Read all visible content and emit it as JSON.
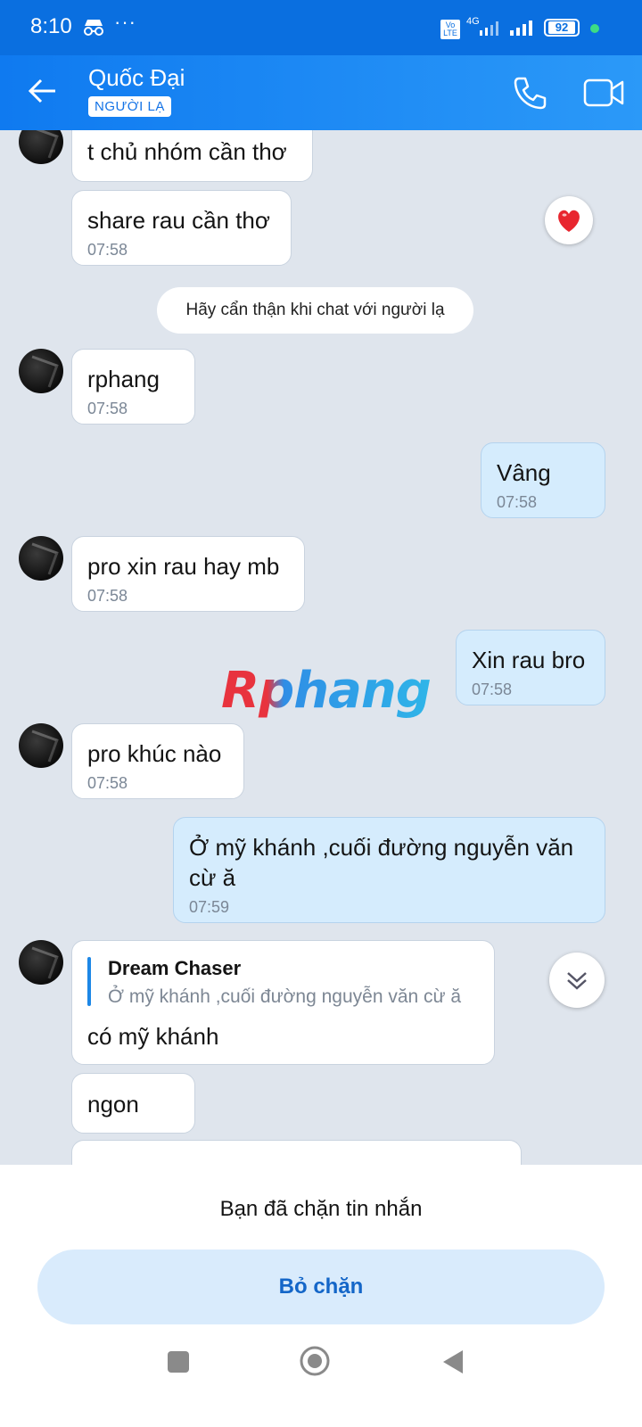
{
  "status_bar": {
    "time": "8:10",
    "more": "···",
    "network_label": "4G",
    "volte_label": "Vo LTE",
    "battery": "92"
  },
  "header": {
    "contact_name": "Quốc Đại",
    "badge": "NGƯỜI LẠ",
    "icons": [
      "back-arrow-icon",
      "phone-icon",
      "video-call-icon"
    ]
  },
  "messages": [
    {
      "side": "in",
      "text": "t chủ nhóm cần thơ",
      "time": ""
    },
    {
      "side": "in",
      "text": "share rau cần thơ",
      "time": "07:58",
      "reaction": "heart"
    },
    {
      "side": "notice",
      "text": "Hãy cẩn thận khi chat với người lạ"
    },
    {
      "side": "in",
      "text": "rphang",
      "time": "07:58"
    },
    {
      "side": "out",
      "text": "Vâng",
      "time": "07:58"
    },
    {
      "side": "in",
      "text": "pro xin rau hay mb",
      "time": "07:58"
    },
    {
      "side": "out",
      "text": "Xin rau bro",
      "time": "07:58"
    },
    {
      "side": "in",
      "text": "pro khúc nào",
      "time": "07:58"
    },
    {
      "side": "out",
      "text_line1": "Ở mỹ khánh ,cuối đường nguyễn văn",
      "text_line2": "cừ  ă",
      "time": "07:59"
    },
    {
      "side": "in",
      "quote_author": "Dream Chaser",
      "quote_text": "Ở mỹ khánh ,cuối đường nguyễn văn cừ  ă",
      "text": "có mỹ khánh"
    },
    {
      "side": "in",
      "text": "ngon"
    }
  ],
  "watermark": "Rphang",
  "bottom": {
    "blocked_text": "Bạn đã chặn tin nhắn",
    "unblock_button": "Bỏ chặn"
  },
  "colors": {
    "header": "#1883f3",
    "incoming_bubble": "#ffffff",
    "outgoing_bubble": "#d5ecfd",
    "chat_background": "#dfe5ed",
    "unblock_button_bg": "#d9ebfc",
    "unblock_button_text": "#1466c8"
  }
}
